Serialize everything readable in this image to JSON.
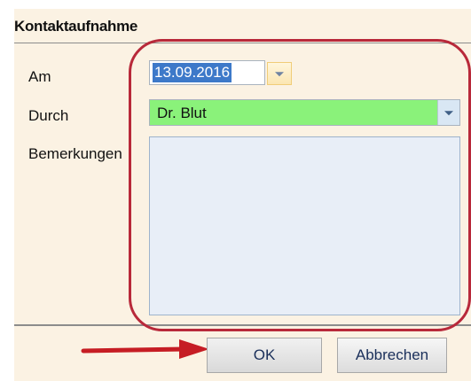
{
  "group": {
    "title": "Kontaktaufnahme"
  },
  "fields": {
    "am": {
      "label": "Am",
      "value": "13.09.2016"
    },
    "durch": {
      "label": "Durch",
      "value": "Dr. Blut",
      "background_color": "#8af27a"
    },
    "bemerkungen": {
      "label": "Bemerkungen",
      "value": ""
    }
  },
  "buttons": {
    "ok_label": "OK",
    "cancel_label": "Abbrechen"
  },
  "icons": {
    "date_dropdown": "chevron-down-icon",
    "combo_dropdown": "chevron-down-icon"
  },
  "annotations": {
    "highlight_color": "#b8293a",
    "arrow_color": "#c61d24"
  }
}
